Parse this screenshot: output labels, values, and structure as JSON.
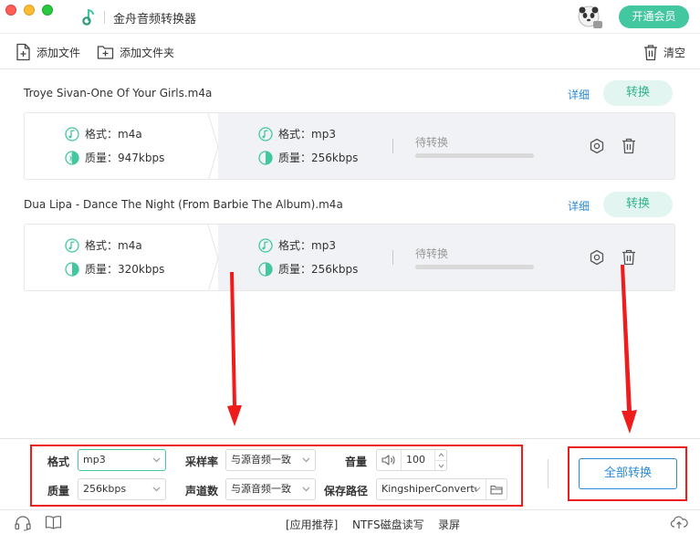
{
  "window": {
    "title": "金舟音频转换器",
    "vip_button": "开通会员"
  },
  "toolbar": {
    "add_file": "添加文件",
    "add_folder": "添加文件夹",
    "clear": "清空"
  },
  "files": [
    {
      "name": "Troye Sivan-One Of Your Girls.m4a",
      "detail": "详细",
      "convert": "转换",
      "source": {
        "format_label": "格式：",
        "format": "m4a",
        "quality_label": "质量：",
        "quality": "947kbps"
      },
      "target": {
        "format_label": "格式：",
        "format": "mp3",
        "quality_label": "质量：",
        "quality": "256kbps"
      },
      "status": "待转换",
      "progress": 0
    },
    {
      "name": "Dua Lipa - Dance The Night (From Barbie The Album).m4a",
      "detail": "详细",
      "convert": "转换",
      "source": {
        "format_label": "格式：",
        "format": "m4a",
        "quality_label": "质量：",
        "quality": "320kbps"
      },
      "target": {
        "format_label": "格式：",
        "format": "mp3",
        "quality_label": "质量：",
        "quality": "256kbps"
      },
      "status": "待转换",
      "progress": 0
    }
  ],
  "settings": {
    "format_label": "格式",
    "format_value": "mp3",
    "quality_label": "质量",
    "quality_value": "256kbps",
    "samplerate_label": "采样率",
    "samplerate_value": "与源音频一致",
    "channels_label": "声道数",
    "channels_value": "与源音频一致",
    "volume_label": "音量",
    "volume_value": "100",
    "path_label": "保存路径",
    "path_value": "KingshiperConverter",
    "convert_all": "全部转换"
  },
  "statusbar": {
    "recommend": "[应用推荐]",
    "ntfs": "NTFS磁盘读写",
    "record": "录屏"
  },
  "colors": {
    "accent": "#43c7a0",
    "link": "#2a8bd8",
    "highlight": "#ee1c1c"
  }
}
